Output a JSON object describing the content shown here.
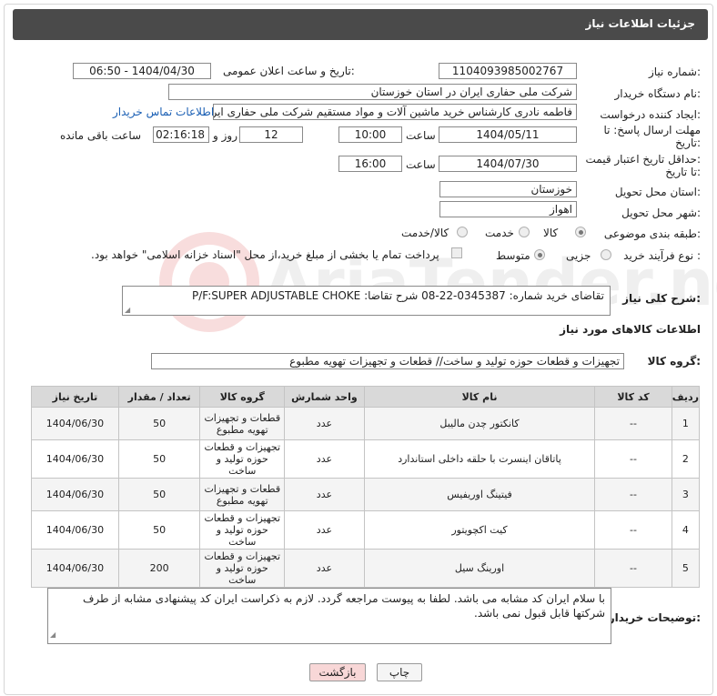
{
  "header": {
    "title": "جزئیات اطلاعات نیاز"
  },
  "form": {
    "need_number_label": "شماره نیاز:",
    "need_number": "1104093985002767",
    "announce_datetime_label": "تاریخ و ساعت اعلان عمومی:",
    "announce_datetime": "1404/04/30 - 06:50",
    "buyer_org_label": "نام دستگاه خریدار:",
    "buyer_org": "شرکت ملی حفاری ایران در استان خوزستان",
    "creator_label": "ایجاد کننده درخواست:",
    "creator": "فاطمه نادری کارشناس خرید ماشین آلات و مواد مستقیم شرکت ملی حفاری ایر",
    "contact_link": "اطلاعات تماس خریدار",
    "reply_deadline_label_1": "مهلت ارسال پاسخ: تا",
    "reply_deadline_label_2": "تاریخ:",
    "reply_date": "1404/05/11",
    "time_label": "ساعت",
    "reply_time": "10:00",
    "days_value": "12",
    "days_label": "روز و",
    "remaining_time": "02:16:18",
    "remaining_label": "ساعت باقی مانده",
    "min_price_label_1": "حداقل تاریخ اعتبار قیمت:",
    "min_price_label_2": "تا تاریخ:",
    "price_date": "1404/07/30",
    "price_time": "16:00",
    "province_label": "استان محل تحویل:",
    "province": "خوزستان",
    "city_label": "شهر محل تحویل:",
    "city": "اهواز",
    "category_label": "طبقه بندی موضوعی:",
    "category_options": [
      "کالا",
      "خدمت",
      "کالا/خدمت"
    ],
    "process_label": "نوع فرآیند خرید :",
    "process_options": [
      "جزیی",
      "متوسط"
    ],
    "payment_note": "پرداخت تمام یا بخشی از مبلغ خرید،از محل \"اسناد خزانه اسلامی\" خواهد بود."
  },
  "description": {
    "label": "شرح کلی نیاز:",
    "text": "تقاضای خرید شماره:  0345387-22-08  شرح تقاضا:  P/F:SUPER ADJUSTABLE CHOKE"
  },
  "goods_section": {
    "title": "اطلاعات کالاهای مورد نیاز"
  },
  "goods_group": {
    "label": "گروه کالا:",
    "value": "تجهیزات و قطعات حوزه تولید و ساخت//  قطعات و تجهیزات تهویه مطبوع"
  },
  "table": {
    "headers": [
      "ردیف",
      "کد کالا",
      "نام کالا",
      "واحد شمارش",
      "گروه کالا",
      "تعداد / مقدار",
      "تاریخ نیاز"
    ],
    "rows": [
      {
        "row": "1",
        "code": "--",
        "name": "کانکتور چدن مالیبل",
        "unit": "عدد",
        "group": "قطعات و تجهیزات تهویه مطبوع",
        "qty": "50",
        "date": "1404/06/30"
      },
      {
        "row": "2",
        "code": "--",
        "name": "پاتاقان اینسرت با حلقه داخلی استاندارد",
        "unit": "عدد",
        "group": "تجهیزات و قطعات حوزه تولید و ساخت",
        "qty": "50",
        "date": "1404/06/30"
      },
      {
        "row": "3",
        "code": "--",
        "name": "فیتینگ اوریفیس",
        "unit": "عدد",
        "group": "قطعات و تجهیزات تهویه مطبوع",
        "qty": "50",
        "date": "1404/06/30"
      },
      {
        "row": "4",
        "code": "--",
        "name": "کیت اکچویتور",
        "unit": "عدد",
        "group": "تجهیزات و قطعات حوزه تولید و ساخت",
        "qty": "50",
        "date": "1404/06/30"
      },
      {
        "row": "5",
        "code": "--",
        "name": "اورینگ سیل",
        "unit": "عدد",
        "group": "تجهیزات و قطعات حوزه تولید و ساخت",
        "qty": "200",
        "date": "1404/06/30"
      }
    ]
  },
  "buyer_notes": {
    "label": "توضیحات خریدار:",
    "text": "با سلام ایران کد مشابه می باشد. لطفا به پیوست مراجعه گردد. لازم به ذکراست ایران کد پیشنهادی مشابه از طرف شرکتها قابل قبول نمی باشد."
  },
  "buttons": {
    "print": "چاپ",
    "back": "بازگشت"
  },
  "watermark": {
    "text": "AriaTender.neT"
  }
}
